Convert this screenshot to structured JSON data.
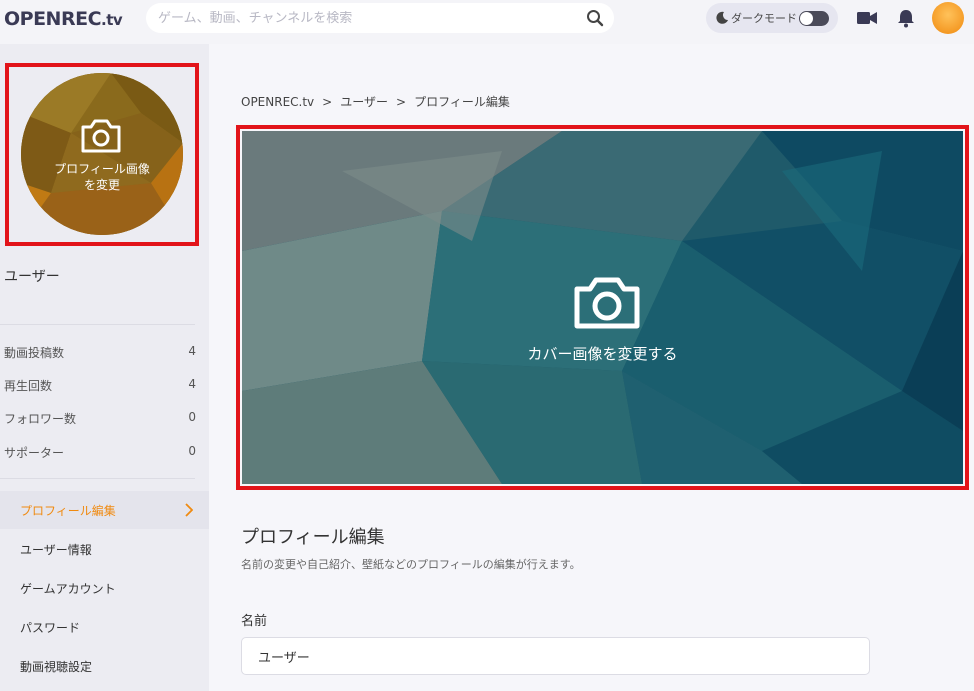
{
  "header": {
    "logo_main": "OPENREC",
    "logo_suffix": ".tv",
    "search_placeholder": "ゲーム、動画、チャンネルを検索",
    "dark_mode_label": "ダークモード"
  },
  "sidebar": {
    "profile_image_label_line1": "プロフィール画像",
    "profile_image_label_line2": "を変更",
    "username": "ユーザー",
    "stats": [
      {
        "label": "動画投稿数",
        "value": "4"
      },
      {
        "label": "再生回数",
        "value": "4"
      },
      {
        "label": "フォロワー数",
        "value": "0"
      },
      {
        "label": "サポーター",
        "value": "0"
      }
    ],
    "nav": [
      {
        "label": "プロフィール編集",
        "active": true
      },
      {
        "label": "ユーザー情報",
        "active": false
      },
      {
        "label": "ゲームアカウント",
        "active": false
      },
      {
        "label": "パスワード",
        "active": false
      },
      {
        "label": "動画視聴設定",
        "active": false
      }
    ]
  },
  "breadcrumb": [
    "OPENREC.tv",
    ">",
    "ユーザー",
    ">",
    "プロフィール編集"
  ],
  "cover": {
    "label": "カバー画像を変更する"
  },
  "section": {
    "title": "プロフィール編集",
    "description": "名前の変更や自己紹介、壁紙などのプロフィールの編集が行えます。"
  },
  "name_field": {
    "label": "名前",
    "value": "ユーザー"
  },
  "colors": {
    "accent": "#f08a10",
    "highlight_border": "#e2141a"
  }
}
